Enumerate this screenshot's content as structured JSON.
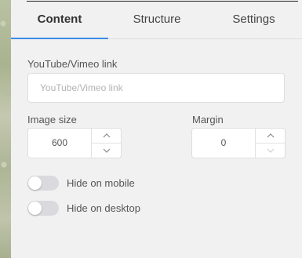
{
  "tabs": [
    {
      "label": "Content",
      "active": true
    },
    {
      "label": "Structure",
      "active": false
    },
    {
      "label": "Settings",
      "active": false
    }
  ],
  "video": {
    "label": "YouTube/Vimeo link",
    "placeholder": "YouTube/Vimeo link",
    "value": ""
  },
  "image_size": {
    "label": "Image size",
    "value": "600"
  },
  "margin": {
    "label": "Margin",
    "value": "0",
    "decrement_disabled": true
  },
  "toggles": [
    {
      "label": "Hide on mobile",
      "on": false
    },
    {
      "label": "Hide on desktop",
      "on": false
    }
  ],
  "colors": {
    "accent": "#3d8be5",
    "panel_bg": "#f1f1f1",
    "toggle_off": "#d9d9de"
  },
  "icons": {
    "increment": "chevron-up-icon",
    "decrement": "chevron-down-icon"
  }
}
